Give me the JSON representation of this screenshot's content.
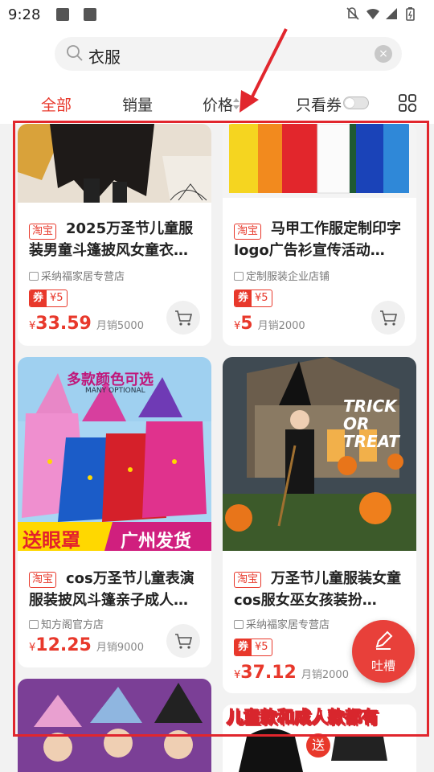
{
  "status": {
    "time": "9:28",
    "right_icons": "mute-icon wifi-icon signal-icon battery-icon"
  },
  "search": {
    "query": "衣服",
    "clear_icon": "×"
  },
  "tabs": {
    "all": "全部",
    "sales": "销量",
    "price": "价格",
    "coupon_only": "只看券"
  },
  "products": [
    {
      "platform": "淘宝",
      "title": "2025万圣节儿童服装男童斗篷披风女童衣…",
      "shop": "采纳福家居专营店",
      "coupon_label": "券",
      "coupon_value": "¥5",
      "currency": "¥",
      "price": "33.59",
      "sales": "月销5000"
    },
    {
      "platform": "淘宝",
      "title": "马甲工作服定制印字logo广告衫宣传活动…",
      "shop": "定制服装企业店铺",
      "coupon_label": "券",
      "coupon_value": "¥5",
      "currency": "¥",
      "price": "5",
      "sales": "月销2000"
    },
    {
      "platform": "淘宝",
      "title": "cos万圣节儿童表演服装披风斗篷亲子成人…",
      "shop": "知方阁官方店",
      "currency": "¥",
      "price": "12.25",
      "sales": "月销9000",
      "image_text_top": "多款颜色可选",
      "image_text_sub": "MANY OPTIONAL",
      "image_text_left": "送眼罩",
      "image_text_right": "广州发货"
    },
    {
      "platform": "淘宝",
      "title": "万圣节儿童服装女童cos服女巫女孩装扮…",
      "shop": "采纳福家居专营店",
      "coupon_label": "券",
      "coupon_value": "¥5",
      "currency": "¥",
      "price": "37.12",
      "sales": "月销2000",
      "image_text": "TRICK OR TREAT"
    }
  ],
  "bottom_card_right_text": "送",
  "fab": {
    "label": "吐槽"
  },
  "annotation": {
    "caption": "儿童款和成人款都有"
  },
  "colors": {
    "accent": "#e8382b",
    "annotation": "#e1262d"
  }
}
